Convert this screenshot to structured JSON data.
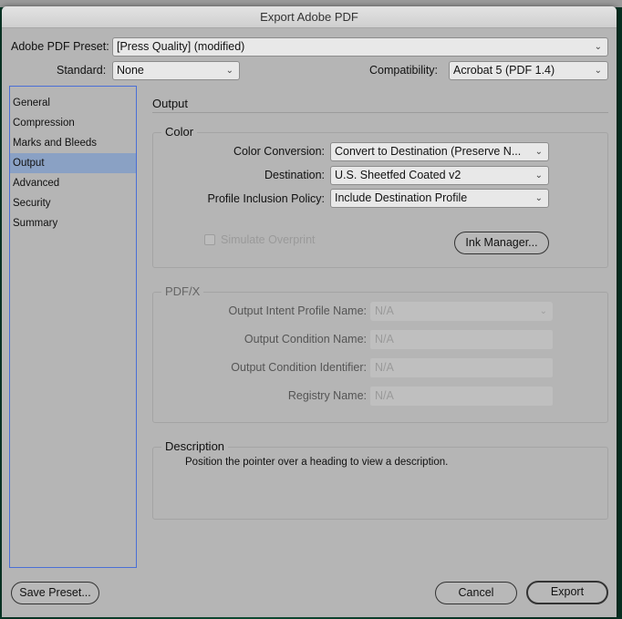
{
  "window": {
    "title": "Export Adobe PDF"
  },
  "preset": {
    "label": "Adobe PDF Preset:",
    "value": "[Press Quality] (modified)"
  },
  "standard": {
    "label": "Standard:",
    "value": "None"
  },
  "compatibility": {
    "label": "Compatibility:",
    "value": "Acrobat 5 (PDF 1.4)"
  },
  "sidebar": {
    "items": [
      {
        "label": "General",
        "active": false
      },
      {
        "label": "Compression",
        "active": false
      },
      {
        "label": "Marks and Bleeds",
        "active": false
      },
      {
        "label": "Output",
        "active": true
      },
      {
        "label": "Advanced",
        "active": false
      },
      {
        "label": "Security",
        "active": false
      },
      {
        "label": "Summary",
        "active": false
      }
    ],
    "accent_color": "#4a6fd6",
    "selected_color": "#8aa1c4"
  },
  "main": {
    "section_title": "Output",
    "color_group": {
      "title": "Color",
      "color_conversion": {
        "label": "Color Conversion:",
        "value": "Convert to Destination (Preserve N..."
      },
      "destination": {
        "label": "Destination:",
        "value": "U.S. Sheetfed Coated v2"
      },
      "profile_policy": {
        "label": "Profile Inclusion Policy:",
        "value": "Include Destination Profile"
      },
      "simulate_overprint": {
        "label": "Simulate Overprint",
        "checked": false,
        "enabled": false
      },
      "ink_manager_label": "Ink Manager..."
    },
    "pdfx_group": {
      "title": "PDF/X",
      "output_intent": {
        "label": "Output Intent Profile Name:",
        "value": "N/A"
      },
      "condition_name": {
        "label": "Output Condition Name:",
        "value": "N/A"
      },
      "condition_identifier": {
        "label": "Output Condition Identifier:",
        "value": "N/A"
      },
      "registry_name": {
        "label": "Registry Name:",
        "value": "N/A"
      }
    },
    "description_group": {
      "title": "Description",
      "text": "Position the pointer over a heading to view a description."
    }
  },
  "footer": {
    "save_preset_label": "Save Preset...",
    "cancel_label": "Cancel",
    "export_label": "Export"
  },
  "icons": {
    "chevron": "⌄"
  }
}
